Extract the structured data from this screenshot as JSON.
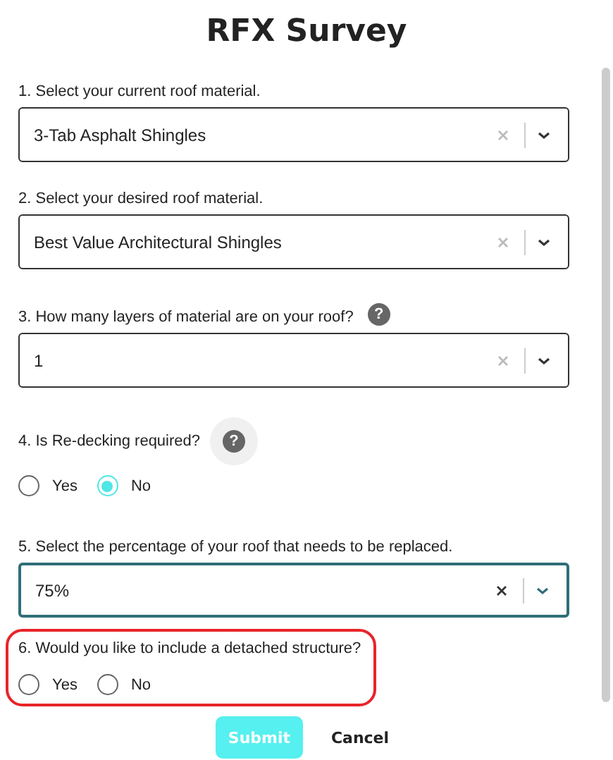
{
  "title": "RFX Survey",
  "questions": [
    {
      "kind": "select",
      "label": "1. Select your current roof material.",
      "value": "3-Tab Asphalt Shingles",
      "focused": false,
      "highlighted": false
    },
    {
      "kind": "select",
      "label": "2. Select your desired roof material.",
      "value": "Best Value Architectural Shingles",
      "focused": false,
      "highlighted": false
    },
    {
      "kind": "select",
      "label": "3. How many layers of material are on your roof?",
      "value": "1",
      "focused": false,
      "help_icon": "?",
      "help_hovered": false,
      "highlighted": false
    },
    {
      "kind": "radio",
      "label": "4. Is Re-decking required?",
      "help_icon": "?",
      "help_hovered": true,
      "highlighted": false,
      "options": [
        {
          "label": "Yes",
          "selected": false
        },
        {
          "label": "No",
          "selected": true
        }
      ]
    },
    {
      "kind": "select",
      "label": "5. Select the percentage of your roof that needs to be replaced.",
      "value": "75%",
      "focused": true,
      "highlighted": false
    },
    {
      "kind": "radio",
      "label": "6. Would you like to include a detached structure?",
      "highlighted": true,
      "options": [
        {
          "label": "Yes",
          "selected": false
        },
        {
          "label": "No",
          "selected": false
        }
      ]
    }
  ],
  "buttons": {
    "submit": "Submit",
    "cancel": "Cancel"
  }
}
